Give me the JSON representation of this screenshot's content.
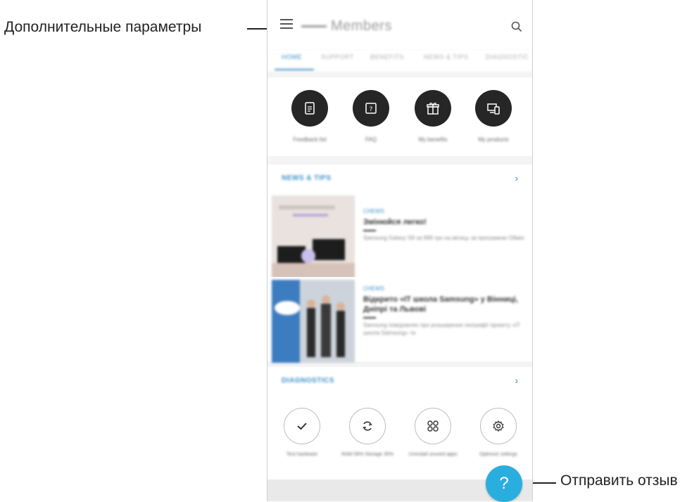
{
  "callouts": {
    "more_options": "Дополнительные параметры",
    "send_feedback": "Отправить отзыв"
  },
  "header": {
    "title": "Members",
    "icons": {
      "menu": "hamburger-icon",
      "search": "search-icon"
    }
  },
  "tabs": [
    {
      "label": "HOME",
      "active": true
    },
    {
      "label": "SUPPORT",
      "active": false
    },
    {
      "label": "BENEFITS",
      "active": false
    },
    {
      "label": "NEWS & TIPS",
      "active": false
    },
    {
      "label": "DIAGNOSTIC",
      "active": false
    }
  ],
  "quick_actions": [
    {
      "label": "Feedback list",
      "icon": "document-icon"
    },
    {
      "label": "FAQ",
      "icon": "faq-icon"
    },
    {
      "label": "My benefits",
      "icon": "gift-icon"
    },
    {
      "label": "My products",
      "icon": "devices-icon"
    }
  ],
  "news_section": {
    "title": "NEWS & TIPS",
    "items": [
      {
        "category": "CHEWS",
        "title": "Змінюйся легко!",
        "description": "Samsung Galaxy S9 за 999 грн на місяць за програмою Обмін"
      },
      {
        "category": "CHEWS",
        "title": "Відкрито «IT школа Samsung» у Вінниці, Дніпрі та Львові",
        "description": "Samsung повідомляє про розширення географії проекту «IT школа Samsung» та"
      }
    ]
  },
  "diagnostics_section": {
    "title": "DIAGNOSTICS",
    "items": [
      {
        "label": "Test hardware",
        "icon": "check-icon"
      },
      {
        "label": "RAM 58% Storage 35%",
        "icon": "refresh-icon"
      },
      {
        "label": "Uninstall unused apps",
        "icon": "apps-grid-icon"
      },
      {
        "label": "Optimize settings",
        "icon": "gear-icon"
      }
    ]
  },
  "fab": {
    "label": "?"
  },
  "colors": {
    "accent": "#3a8fc9",
    "fab": "#2aaee0",
    "icon_bg": "#262626"
  }
}
